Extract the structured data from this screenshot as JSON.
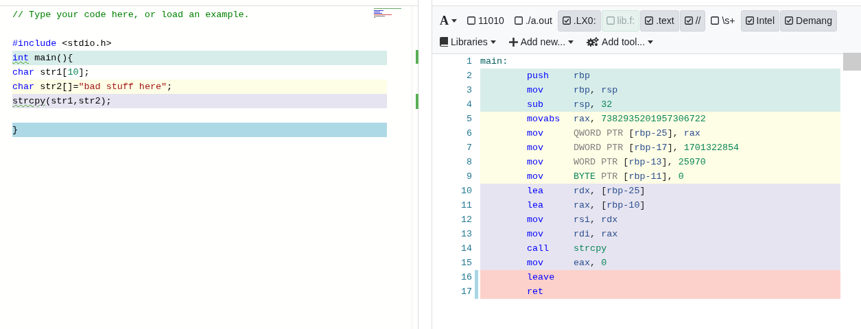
{
  "source_editor": {
    "lines": [
      {
        "kind": "code",
        "color": "#fffffe",
        "tokens": [
          {
            "kind": "comment",
            "text": "// Type your code here, or load an example.",
            "warning": false
          }
        ]
      },
      {
        "kind": "blank"
      },
      {
        "kind": "code",
        "color": "#fffffe",
        "tokens": [
          {
            "kind": "keyword",
            "text": "#include",
            "warning": false
          },
          {
            "kind": "plain",
            "text": " <stdio.h>",
            "warning": false
          }
        ]
      },
      {
        "kind": "code",
        "color": "#d7ede9",
        "tokens": [
          {
            "kind": "keyword",
            "text": "int",
            "warning": true
          },
          {
            "kind": "plain",
            "text": " main(){",
            "warning": false
          }
        ]
      },
      {
        "kind": "code",
        "color": "#fffffe",
        "tokens": [
          {
            "kind": "keyword",
            "text": "char",
            "warning": false
          },
          {
            "kind": "plain",
            "text": " str1[",
            "warning": false
          },
          {
            "kind": "number",
            "text": "10",
            "warning": false
          },
          {
            "kind": "plain",
            "text": "];",
            "warning": false
          }
        ]
      },
      {
        "kind": "code",
        "color": "#fefde5",
        "tokens": [
          {
            "kind": "keyword",
            "text": "char",
            "warning": false
          },
          {
            "kind": "plain",
            "text": " str2[]=",
            "warning": false
          },
          {
            "kind": "string",
            "text": "\"bad stuff here\"",
            "warning": false
          },
          {
            "kind": "plain",
            "text": ";",
            "warning": false
          }
        ]
      },
      {
        "kind": "code",
        "color": "#e6e4f0",
        "tokens": [
          {
            "kind": "plain",
            "text": "strcpy",
            "warning": true
          },
          {
            "kind": "plain",
            "text": "(str1,str2);",
            "warning": false
          }
        ]
      },
      {
        "kind": "blank"
      },
      {
        "kind": "code",
        "color": "#add8e6",
        "tokens": [
          {
            "kind": "plain",
            "text": "}",
            "warning": false
          }
        ]
      }
    ]
  },
  "output_toolbar": {
    "font_button": {
      "label": "A"
    },
    "filters": [
      {
        "label": "11010",
        "checked": false,
        "pressed": false,
        "disabled": false
      },
      {
        "label": "./a.out",
        "checked": false,
        "pressed": false,
        "disabled": false
      },
      {
        "label": ".LX0:",
        "checked": true,
        "pressed": true,
        "disabled": false
      },
      {
        "label": "lib.f:",
        "checked": false,
        "pressed": false,
        "disabled": true
      },
      {
        "label": ".text",
        "checked": true,
        "pressed": true,
        "disabled": false
      },
      {
        "label": "//",
        "checked": true,
        "pressed": true,
        "disabled": false
      },
      {
        "label": "\\s+",
        "checked": false,
        "pressed": false,
        "disabled": false
      },
      {
        "label": "Intel",
        "checked": true,
        "pressed": true,
        "disabled": false
      },
      {
        "label": "Demang",
        "checked": true,
        "pressed": true,
        "disabled": false
      }
    ],
    "menus": [
      {
        "kind": "book",
        "label": "Libraries"
      },
      {
        "kind": "plus",
        "label": "Add new..."
      },
      {
        "kind": "gears",
        "label": "Add tool..."
      }
    ]
  },
  "assembly": {
    "lines": [
      {
        "number": "1",
        "label": "main:",
        "color": "#ffffff",
        "marked": false
      },
      {
        "number": "2",
        "mnemonic": "push",
        "operands": [
          {
            "kind": "reg",
            "text": "rbp"
          }
        ],
        "color": "#d7ede9",
        "marked": false
      },
      {
        "number": "3",
        "mnemonic": "mov",
        "operands": [
          {
            "kind": "reg",
            "text": "rbp"
          },
          {
            "kind": "punct",
            "text": ", "
          },
          {
            "kind": "reg",
            "text": "rsp"
          }
        ],
        "color": "#d7ede9",
        "marked": false
      },
      {
        "number": "4",
        "mnemonic": "sub",
        "operands": [
          {
            "kind": "reg",
            "text": "rsp"
          },
          {
            "kind": "punct",
            "text": ", "
          },
          {
            "kind": "number",
            "text": "32"
          }
        ],
        "color": "#d7ede9",
        "marked": false
      },
      {
        "number": "5",
        "mnemonic": "movabs",
        "operands": [
          {
            "kind": "reg",
            "text": "rax"
          },
          {
            "kind": "punct",
            "text": ", "
          },
          {
            "kind": "number",
            "text": "7382935201957306722"
          }
        ],
        "color": "#fefde5",
        "marked": false
      },
      {
        "number": "6",
        "mnemonic": "mov",
        "operands": [
          {
            "kind": "size",
            "text": "QWORD PTR "
          },
          {
            "kind": "punct",
            "text": "["
          },
          {
            "kind": "reg",
            "text": "rbp-25"
          },
          {
            "kind": "punct",
            "text": "], "
          },
          {
            "kind": "reg",
            "text": "rax"
          }
        ],
        "color": "#fefde5",
        "marked": false
      },
      {
        "number": "7",
        "mnemonic": "mov",
        "operands": [
          {
            "kind": "size",
            "text": "DWORD PTR "
          },
          {
            "kind": "punct",
            "text": "["
          },
          {
            "kind": "reg",
            "text": "rbp-17"
          },
          {
            "kind": "punct",
            "text": "], "
          },
          {
            "kind": "number",
            "text": "1701322854"
          }
        ],
        "color": "#fefde5",
        "marked": false
      },
      {
        "number": "8",
        "mnemonic": "mov",
        "operands": [
          {
            "kind": "size",
            "text": "WORD PTR "
          },
          {
            "kind": "punct",
            "text": "["
          },
          {
            "kind": "reg",
            "text": "rbp-13"
          },
          {
            "kind": "punct",
            "text": "], "
          },
          {
            "kind": "number",
            "text": "25970"
          }
        ],
        "color": "#fefde5",
        "marked": false
      },
      {
        "number": "9",
        "mnemonic": "mov",
        "operands": [
          {
            "kind": "number",
            "text": "BYTE"
          },
          {
            "kind": "size",
            "text": " PTR "
          },
          {
            "kind": "punct",
            "text": "["
          },
          {
            "kind": "reg",
            "text": "rbp-11"
          },
          {
            "kind": "punct",
            "text": "], "
          },
          {
            "kind": "number",
            "text": "0"
          }
        ],
        "color": "#fefde5",
        "marked": false
      },
      {
        "number": "10",
        "mnemonic": "lea",
        "operands": [
          {
            "kind": "reg",
            "text": "rdx"
          },
          {
            "kind": "punct",
            "text": ", ["
          },
          {
            "kind": "reg",
            "text": "rbp-25"
          },
          {
            "kind": "punct",
            "text": "]"
          }
        ],
        "color": "#e6e4f0",
        "marked": false
      },
      {
        "number": "11",
        "mnemonic": "lea",
        "operands": [
          {
            "kind": "reg",
            "text": "rax"
          },
          {
            "kind": "punct",
            "text": ", ["
          },
          {
            "kind": "reg",
            "text": "rbp-10"
          },
          {
            "kind": "punct",
            "text": "]"
          }
        ],
        "color": "#e6e4f0",
        "marked": false
      },
      {
        "number": "12",
        "mnemonic": "mov",
        "operands": [
          {
            "kind": "reg",
            "text": "rsi"
          },
          {
            "kind": "punct",
            "text": ", "
          },
          {
            "kind": "reg",
            "text": "rdx"
          }
        ],
        "color": "#e6e4f0",
        "marked": false
      },
      {
        "number": "13",
        "mnemonic": "mov",
        "operands": [
          {
            "kind": "reg",
            "text": "rdi"
          },
          {
            "kind": "punct",
            "text": ", "
          },
          {
            "kind": "reg",
            "text": "rax"
          }
        ],
        "color": "#e6e4f0",
        "marked": false
      },
      {
        "number": "14",
        "mnemonic": "call",
        "operands": [
          {
            "kind": "symbol",
            "text": "strcpy"
          }
        ],
        "color": "#e6e4f0",
        "marked": false
      },
      {
        "number": "15",
        "mnemonic": "mov",
        "operands": [
          {
            "kind": "reg",
            "text": "eax"
          },
          {
            "kind": "punct",
            "text": ", "
          },
          {
            "kind": "number",
            "text": "0"
          }
        ],
        "color": "#e6e4f0",
        "marked": false
      },
      {
        "number": "16",
        "mnemonic": "leave",
        "color": "#fcd1cb",
        "marked": true
      },
      {
        "number": "17",
        "mnemonic": "ret",
        "color": "#fcd1cb",
        "marked": true
      }
    ]
  }
}
